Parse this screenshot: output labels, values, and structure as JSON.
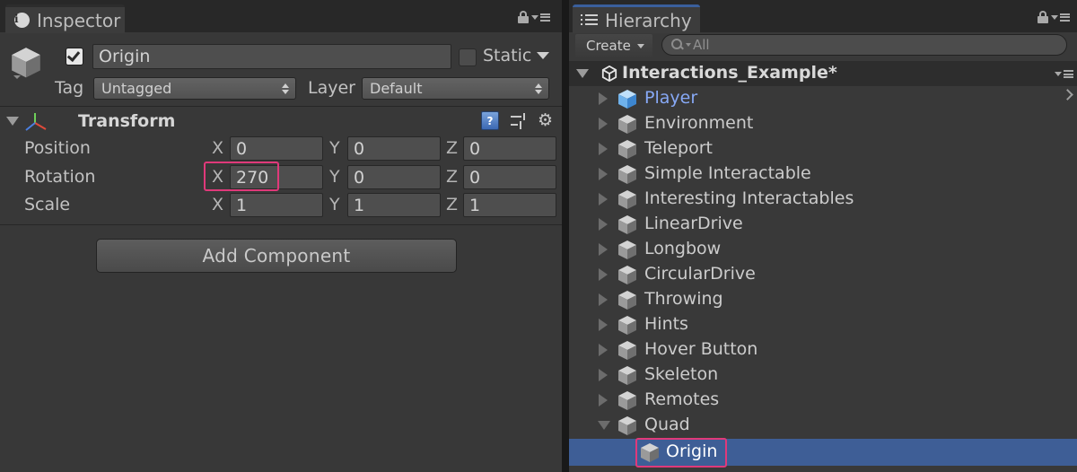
{
  "inspector": {
    "tab_label": "Inspector",
    "object_name": "Origin",
    "active_checked": true,
    "static_label": "Static",
    "static_checked": false,
    "tag_label": "Tag",
    "tag_value": "Untagged",
    "layer_label": "Layer",
    "layer_value": "Default",
    "transform": {
      "title": "Transform",
      "help_glyph": "?",
      "rows": [
        {
          "label": "Position",
          "x": "0",
          "y": "0",
          "z": "0"
        },
        {
          "label": "Rotation",
          "x": "270",
          "y": "0",
          "z": "0"
        },
        {
          "label": "Scale",
          "x": "1",
          "y": "1",
          "z": "1"
        }
      ],
      "axis": {
        "x": "X",
        "y": "Y",
        "z": "Z"
      },
      "highlighted_field": "rotation.x"
    },
    "add_component_label": "Add Component"
  },
  "hierarchy": {
    "tab_label": "Hierarchy",
    "create_label": "Create",
    "search_placeholder": "All",
    "scene_name": "Interactions_Example*",
    "items": [
      {
        "label": "Player",
        "prefab": true,
        "expanded": false,
        "depth": 0
      },
      {
        "label": "Environment",
        "prefab": false,
        "expanded": false,
        "depth": 0
      },
      {
        "label": "Teleport",
        "prefab": false,
        "expanded": false,
        "depth": 0
      },
      {
        "label": "Simple Interactable",
        "prefab": false,
        "expanded": false,
        "depth": 0
      },
      {
        "label": "Interesting Interactables",
        "prefab": false,
        "expanded": false,
        "depth": 0
      },
      {
        "label": "LinearDrive",
        "prefab": false,
        "expanded": false,
        "depth": 0
      },
      {
        "label": "Longbow",
        "prefab": false,
        "expanded": false,
        "depth": 0
      },
      {
        "label": "CircularDrive",
        "prefab": false,
        "expanded": false,
        "depth": 0
      },
      {
        "label": "Throwing",
        "prefab": false,
        "expanded": false,
        "depth": 0
      },
      {
        "label": "Hints",
        "prefab": false,
        "expanded": false,
        "depth": 0
      },
      {
        "label": "Hover Button",
        "prefab": false,
        "expanded": false,
        "depth": 0
      },
      {
        "label": "Skeleton",
        "prefab": false,
        "expanded": false,
        "depth": 0
      },
      {
        "label": "Remotes",
        "prefab": false,
        "expanded": false,
        "depth": 0
      },
      {
        "label": "Quad",
        "prefab": false,
        "expanded": true,
        "depth": 0
      },
      {
        "label": "Origin",
        "prefab": false,
        "expanded": false,
        "depth": 1,
        "selected": true
      }
    ]
  },
  "colors": {
    "panel_bg": "#383838",
    "selection": "#3e5e96",
    "highlight_box": "#e0397a",
    "prefab_text": "#87a9f6"
  },
  "icons": [
    "info-icon",
    "list-icon",
    "lock-icon",
    "menu-icon",
    "gameobject-cube-icon",
    "transform-axes-icon",
    "help-icon",
    "preset-icon",
    "gear-icon",
    "search-icon",
    "unity-scene-icon",
    "prefab-cube-icon"
  ]
}
